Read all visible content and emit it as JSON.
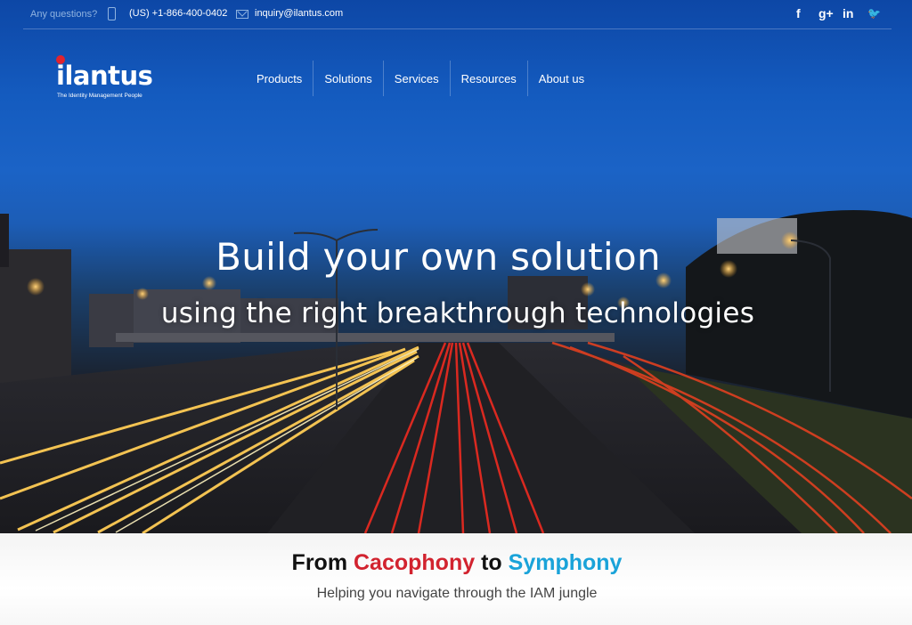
{
  "topbar": {
    "question": "Any questions?",
    "phone": "(US) +1-866-400-0402",
    "email": "inquiry@ilantus.com",
    "social": [
      {
        "name": "facebook-icon",
        "glyph": "f"
      },
      {
        "name": "google-plus-icon",
        "glyph": "g+"
      },
      {
        "name": "linkedin-icon",
        "glyph": "in"
      },
      {
        "name": "twitter-icon",
        "glyph": "🐦"
      }
    ]
  },
  "logo": {
    "word": "ilantus",
    "tagline": "The Identity Management People",
    "accent": "#e0232e"
  },
  "nav": {
    "items": [
      "Products",
      "Solutions",
      "Services",
      "Resources",
      "About us"
    ]
  },
  "hero": {
    "headline": "Build your own solution",
    "subheadline": "using the right breakthrough technologies"
  },
  "intro": {
    "from": "From",
    "cacophony": "Cacophony",
    "to": "to",
    "symphony": "Symphony",
    "subtitle": "Helping you navigate through the IAM jungle"
  },
  "colors": {
    "red": "#d2232f",
    "blue": "#1aa3d9",
    "sky": "#1b63c6"
  }
}
